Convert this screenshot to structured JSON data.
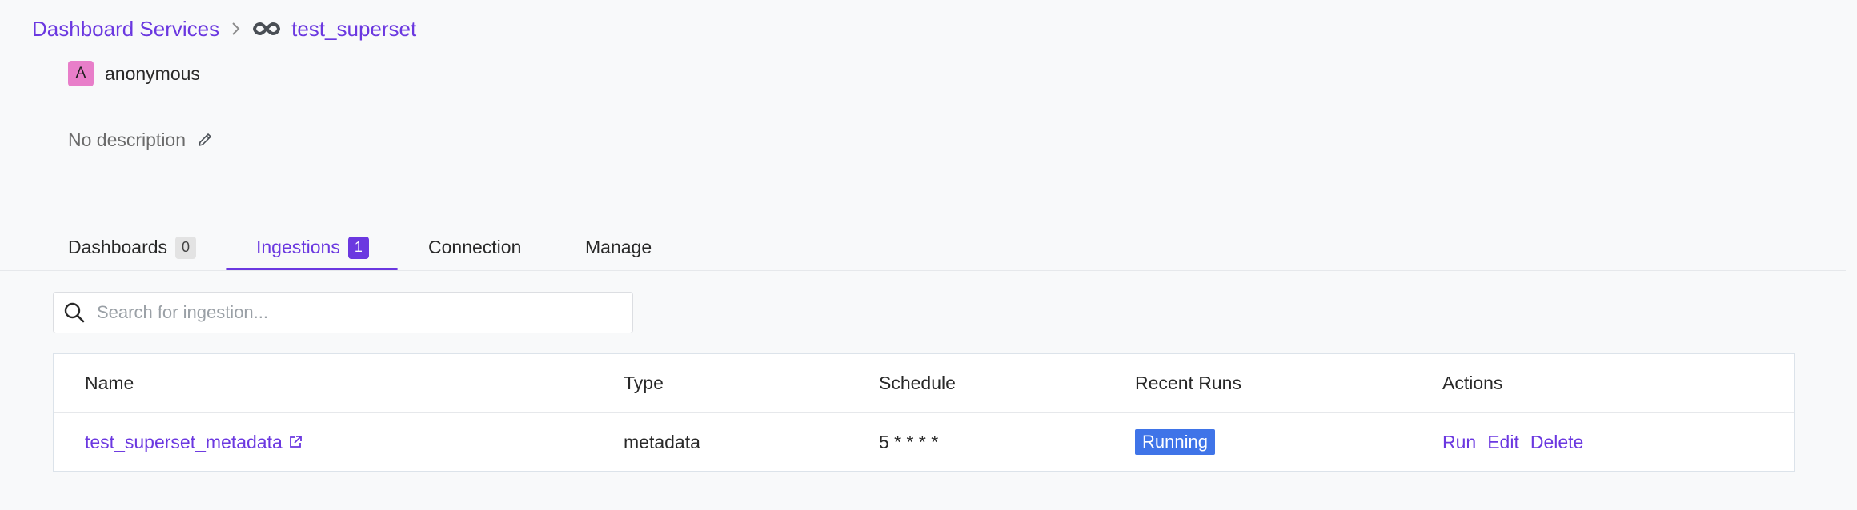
{
  "breadcrumb": {
    "parent": "Dashboard Services",
    "current": "test_superset",
    "service_icon": "superset-infinity-icon"
  },
  "owner": {
    "avatar_letter": "A",
    "name": "anonymous"
  },
  "description": {
    "text": "No description",
    "edit_icon": "pencil-icon"
  },
  "tabs": [
    {
      "label": "Dashboards",
      "count": "0"
    },
    {
      "label": "Ingestions",
      "count": "1",
      "active": true
    },
    {
      "label": "Connection"
    },
    {
      "label": "Manage"
    }
  ],
  "search": {
    "placeholder": "Search for ingestion...",
    "value": ""
  },
  "table": {
    "headers": [
      "Name",
      "Type",
      "Schedule",
      "Recent Runs",
      "Actions"
    ],
    "rows": [
      {
        "name": "test_superset_metadata",
        "type": "metadata",
        "schedule": "5 * * * *",
        "recent_run": "Running",
        "actions": [
          "Run",
          "Edit",
          "Delete"
        ]
      }
    ]
  },
  "colors": {
    "accent": "#6b38e0",
    "status_running": "#3f74e8",
    "avatar": "#e87ec9"
  }
}
